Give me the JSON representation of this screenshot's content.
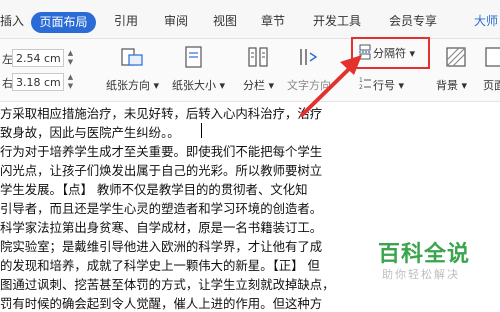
{
  "tabs": {
    "partial": "插入",
    "page_layout": "页面布局",
    "references": "引用",
    "review": "审阅",
    "view": "视图",
    "chapter": "章节",
    "developer": "开发工具",
    "member": "会员专享",
    "right_partial": "大师"
  },
  "ribbon": {
    "left_label": "左",
    "left_value": "2.54 cm",
    "right_label": "右",
    "right_value": "3.18 cm",
    "orientation": "纸张方向",
    "size": "纸张大小",
    "columns": "分栏",
    "text_direction": "文字方向",
    "separator": "分隔符",
    "line_number": "行号",
    "background": "背景",
    "border_partial": "页面"
  },
  "document": {
    "lines": [
      "方采取相应措施治疗，未见好转，后转入心内科治疗，治疗",
      "致身故，因此与医院产生纠纷。。",
      "行为对于培养学生成才至关重要。即使我们不能把每个学生",
      "闪光点，让孩子们焕发出属于自己的光彩。所以教师要树立",
      "学生发展。【点】    教师不仅是教学目的的贯彻者、文化知",
      "引导者，而且还是学生心灵的塑造者和学习环境的创造者。",
      "科学家法拉第出身贫寒、自学成材，原是一名书籍装订工。",
      "院实验室；是戴维引导他进入欧洲的科学界，才让他有了成",
      "的发现和培养，成就了科学史上一颗伟大的新星。【正】   但",
      "图通过讽刺、挖苦甚至体罚的方式，让学生立刻就改掉缺点，",
      "罚有时候的确会起到令人觉醒，催人上进的作用。但这种方"
    ]
  },
  "watermark": {
    "title": "百科全说",
    "subtitle": "助你轻松解决"
  },
  "colors": {
    "accent": "#2a6cd6",
    "highlight": "#e3312d",
    "watermark": "#3aa54d"
  }
}
